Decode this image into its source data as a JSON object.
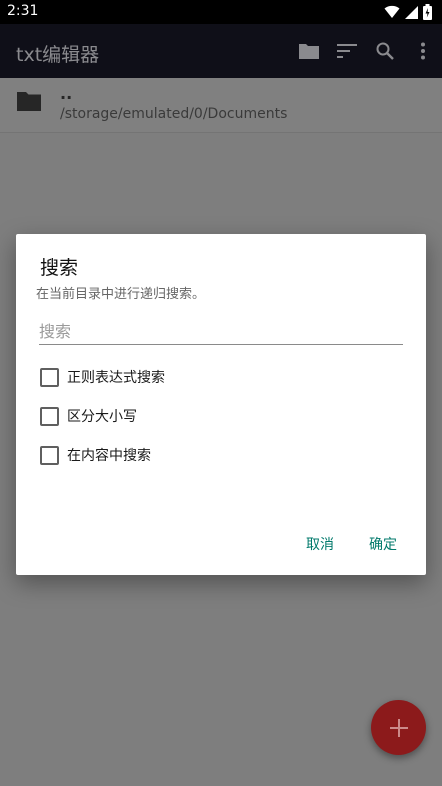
{
  "status_bar": {
    "time": "2:31",
    "icons": [
      "wifi-icon",
      "cell-signal-icon",
      "battery-icon"
    ]
  },
  "app_bar": {
    "title": "txt编辑器",
    "actions": [
      "folder-icon",
      "sort-icon",
      "search-icon",
      "more-vert-icon"
    ]
  },
  "path_row": {
    "icon": "folder-icon",
    "name": "..",
    "path": "/storage/emulated/0/Documents"
  },
  "dialog": {
    "title": "搜索",
    "message": "在当前目录中进行递归搜索。",
    "input": {
      "value": "",
      "placeholder": "搜索"
    },
    "options": [
      {
        "label": "正则表达式搜索",
        "checked": false
      },
      {
        "label": "区分大小写",
        "checked": false
      },
      {
        "label": "在内容中搜索",
        "checked": false
      }
    ],
    "cancel_label": "取消",
    "ok_label": "确定"
  },
  "fab": {
    "icon": "add-icon"
  },
  "colors": {
    "accent": "#00796b",
    "app_bar": "#0f0f18",
    "fab": "#8c1a1b",
    "scrim": "#7e7e7e"
  }
}
